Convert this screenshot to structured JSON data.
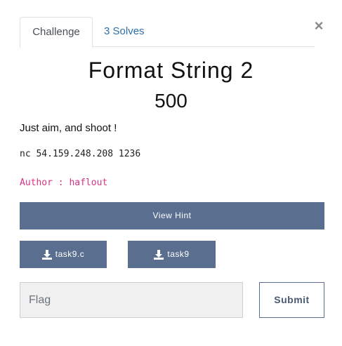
{
  "tabs": [
    {
      "label": "Challenge",
      "active": true
    },
    {
      "label": "3 Solves",
      "active": false
    }
  ],
  "close_glyph": "×",
  "challenge": {
    "name": "Format String 2",
    "points": "500",
    "description": "Just aim, and shoot !",
    "connection": "nc 54.159.248.208 1236",
    "author": "Author : haflout"
  },
  "buttons": {
    "view_hint": "View Hint",
    "files": [
      "task9.c",
      "task9"
    ],
    "submit": "Submit"
  },
  "flag_input": {
    "placeholder": "Flag",
    "value": ""
  },
  "colors": {
    "button_bg": "#5a6f8f",
    "link": "#2d6ea8",
    "author_text": "#d63384"
  },
  "icons": {
    "download": "download-icon",
    "close": "close-icon"
  }
}
